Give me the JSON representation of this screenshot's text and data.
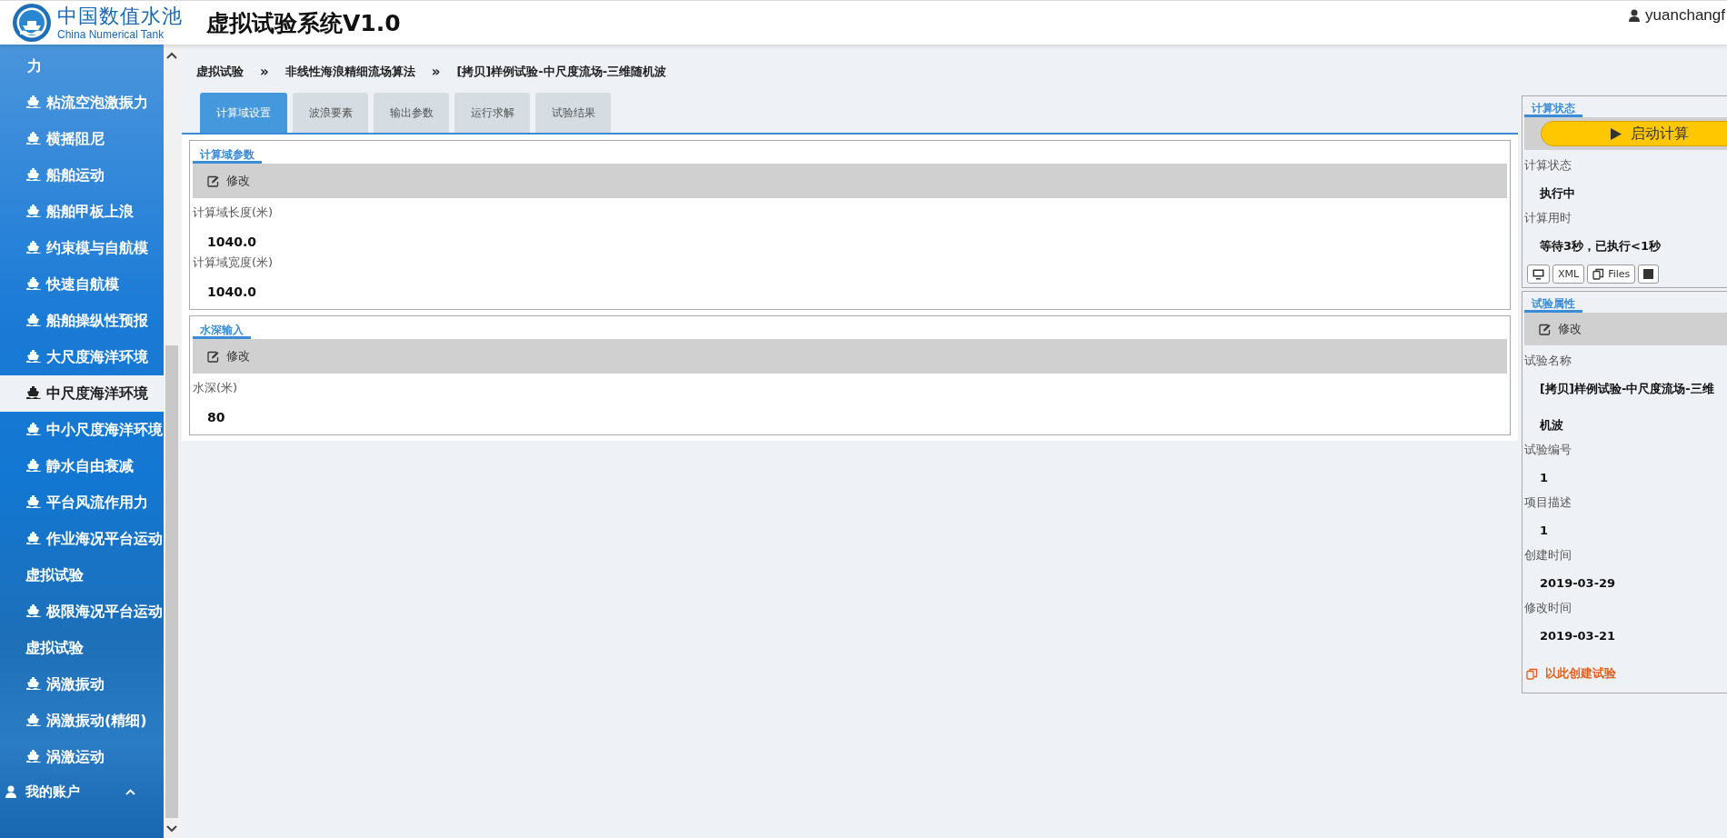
{
  "header": {
    "brand_cn": "中国数值水池",
    "brand_en": "China Numerical Tank",
    "title": "虚拟试验系统V1.0",
    "user": "yuanchangf"
  },
  "sidebar": {
    "items": [
      {
        "label": "力",
        "kind": "tail",
        "selected": false
      },
      {
        "label": "粘流空泡激振力",
        "kind": "item",
        "selected": false
      },
      {
        "label": "横摇阻尼",
        "kind": "item",
        "selected": false
      },
      {
        "label": "船舶运动",
        "kind": "item",
        "selected": false
      },
      {
        "label": "船舶甲板上浪",
        "kind": "item",
        "selected": false
      },
      {
        "label": "约束模与自航模",
        "kind": "item",
        "selected": false
      },
      {
        "label": "快速自航模",
        "kind": "item",
        "selected": false
      },
      {
        "label": "船舶操纵性预报",
        "kind": "item",
        "selected": false
      },
      {
        "label": "大尺度海洋环境",
        "kind": "item",
        "selected": false
      },
      {
        "label": "中尺度海洋环境",
        "kind": "item",
        "selected": true
      },
      {
        "label": "中小尺度海洋环境",
        "kind": "item",
        "selected": false
      },
      {
        "label": "静水自由衰减",
        "kind": "item",
        "selected": false
      },
      {
        "label": "平台风流作用力",
        "kind": "item",
        "selected": false
      },
      {
        "label": "作业海况平台运动虚拟试验",
        "kind": "item",
        "selected": false
      },
      {
        "label": "极限海况平台运动虚拟试验",
        "kind": "item",
        "selected": false
      },
      {
        "label": "涡激振动",
        "kind": "item",
        "selected": false
      },
      {
        "label": "涡激振动(精细)",
        "kind": "item",
        "selected": false
      },
      {
        "label": "涡激运动",
        "kind": "item",
        "selected": false
      }
    ],
    "account": "我的账户"
  },
  "breadcrumb": {
    "separator": "»",
    "items": [
      "虚拟试验",
      "非线性海浪精细流场算法",
      "[拷贝]样例试验-中尺度流场-三维随机波"
    ]
  },
  "tabs": [
    {
      "label": "计算域设置",
      "selected": true
    },
    {
      "label": "波浪要素",
      "selected": false
    },
    {
      "label": "输出参数",
      "selected": false
    },
    {
      "label": "运行求解",
      "selected": false
    },
    {
      "label": "试验结果",
      "selected": false
    }
  ],
  "sections": [
    {
      "title": "计算域参数",
      "edit": "修改",
      "fields": [
        {
          "label": "计算域长度(米)",
          "value": "1040.0"
        },
        {
          "label": "计算域宽度(米)",
          "value": "1040.0"
        }
      ]
    },
    {
      "title": "水深输入",
      "edit": "修改",
      "fields": [
        {
          "label": "水深(米)",
          "value": "80"
        }
      ]
    }
  ],
  "status_panel": {
    "title": "计算状态",
    "start_button": "启动计算",
    "fields": [
      {
        "label": "计算状态",
        "value": "执行中"
      },
      {
        "label": "计算用时",
        "value": "等待3秒，已执行<1秒"
      }
    ],
    "tools": [
      {
        "kind": "monitor"
      },
      {
        "kind": "text",
        "label": "XML"
      },
      {
        "kind": "files",
        "label": "Files"
      },
      {
        "kind": "stop"
      }
    ]
  },
  "properties_panel": {
    "title": "试验属性",
    "edit": "修改",
    "fields": [
      {
        "label": "试验名称",
        "value_lines": [
          "[拷贝]样例试验-中尺度流场-三维",
          "机波"
        ]
      },
      {
        "label": "试验编号",
        "value_lines": [
          "1"
        ]
      },
      {
        "label": "项目描述",
        "value_lines": [
          "1"
        ]
      },
      {
        "label": "创建时间",
        "value_lines": [
          "2019-03-29"
        ]
      },
      {
        "label": "修改时间",
        "value_lines": [
          "2019-03-21"
        ]
      }
    ],
    "create_link": "以此创建试验"
  }
}
